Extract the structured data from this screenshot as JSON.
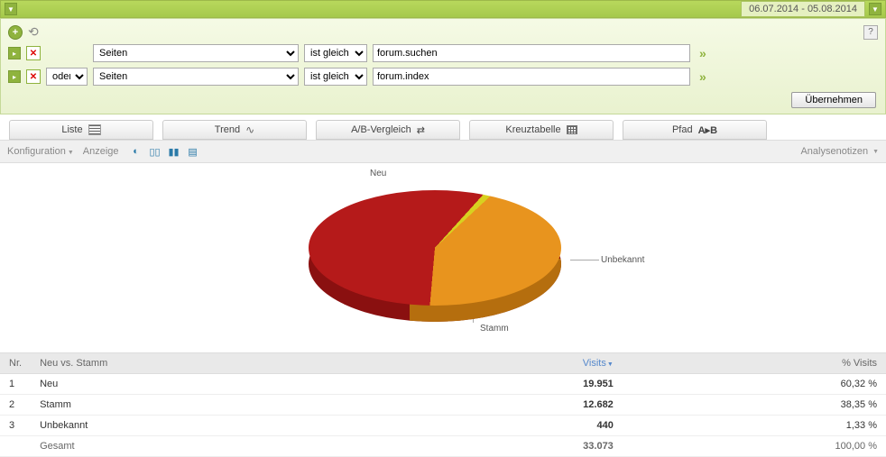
{
  "header": {
    "date_range": "06.07.2014 - 05.08.2014"
  },
  "filters": {
    "rows": [
      {
        "conj": "",
        "dimension": "Seiten",
        "operator": "ist gleich",
        "value": "forum.suchen"
      },
      {
        "conj": "oder",
        "dimension": "Seiten",
        "operator": "ist gleich",
        "value": "forum.index"
      }
    ],
    "apply_label": "Übernehmen"
  },
  "tabs": {
    "list": "Liste",
    "trend": "Trend",
    "ab": "A/B-Vergleich",
    "cross": "Kreuztabelle",
    "path": "Pfad"
  },
  "configbar": {
    "config": "Konfiguration",
    "view": "Anzeige",
    "notes": "Analysenotizen"
  },
  "chart_data": {
    "type": "pie",
    "title": "",
    "series": [
      {
        "name": "Neu",
        "value": 19951,
        "pct": 60.32,
        "color": "#b51a1a"
      },
      {
        "name": "Stamm",
        "value": 12682,
        "pct": 38.35,
        "color": "#e8941e"
      },
      {
        "name": "Unbekannt",
        "value": 440,
        "pct": 1.33,
        "color": "#d8d020"
      }
    ],
    "labels": {
      "neu": "Neu",
      "stamm": "Stamm",
      "unbekannt": "Unbekannt"
    }
  },
  "table": {
    "columns": {
      "nr": "Nr.",
      "name": "Neu vs. Stamm",
      "visits": "Visits",
      "pct": "% Visits"
    },
    "rows": [
      {
        "nr": "1",
        "name": "Neu",
        "visits": "19.951",
        "pct": "60,32 %"
      },
      {
        "nr": "2",
        "name": "Stamm",
        "visits": "12.682",
        "pct": "38,35 %"
      },
      {
        "nr": "3",
        "name": "Unbekannt",
        "visits": "440",
        "pct": "1,33 %"
      }
    ],
    "total": {
      "name": "Gesamt",
      "visits": "33.073",
      "pct": "100,00 %"
    }
  }
}
